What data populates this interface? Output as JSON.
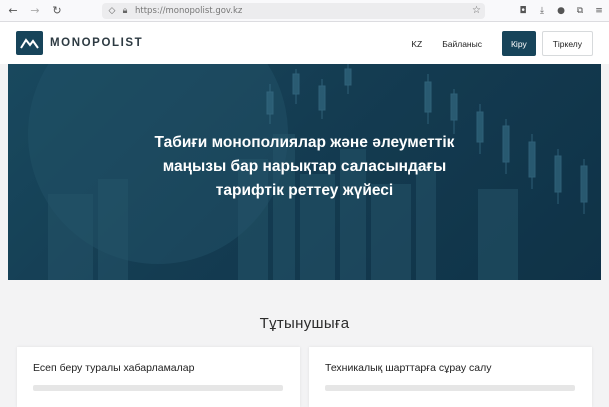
{
  "browser": {
    "url": "https://monopolist.gov.kz"
  },
  "header": {
    "logo_text": "MONOPOLIST",
    "lang": "KZ",
    "contact": "Байланыс",
    "login": "Кіру",
    "register": "Тіркелу"
  },
  "hero": {
    "line1": "Табиғи монополиялар және әлеуметтік",
    "line2": "маңызы бар нарықтар саласындағы",
    "line3": "тарифтік реттеу жүйесі"
  },
  "section": {
    "title": "Тұтынушыға"
  },
  "cards": [
    {
      "title": "Есеп беру туралы хабарламалар"
    },
    {
      "title": "Техникалық шарттарға сұрау салу"
    }
  ],
  "colors": {
    "brand": "#17445a",
    "hero_bg": "#163f55"
  }
}
